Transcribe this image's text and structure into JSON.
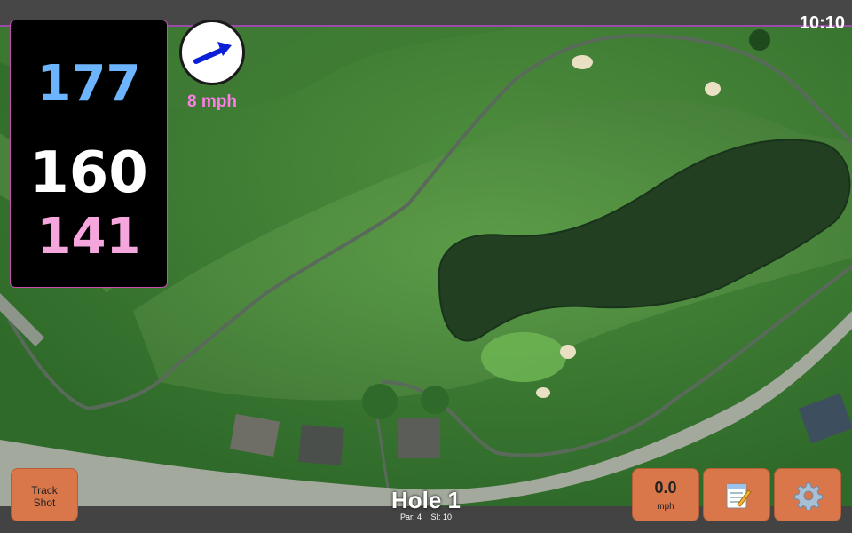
{
  "status_bar": {
    "time": "10:10"
  },
  "yardages": {
    "back": "177",
    "center": "160",
    "front": "141"
  },
  "wind": {
    "speed": "8 mph",
    "direction_icon": "wind-arrow-icon"
  },
  "hole": {
    "title": "Hole 1",
    "par": "Par: 4",
    "si": "SI: 10"
  },
  "buttons": {
    "track_shot": "Track Shot",
    "speed_value": "0.0",
    "speed_unit": "mph",
    "notes_icon": "notepad-icon",
    "settings_icon": "gear-icon"
  },
  "colors": {
    "back_yardage": "#6db4ff",
    "center_yardage": "#ffffff",
    "front_yardage": "#f4a6dd",
    "wind_text": "#ff7de8",
    "button": "#d9774a"
  }
}
